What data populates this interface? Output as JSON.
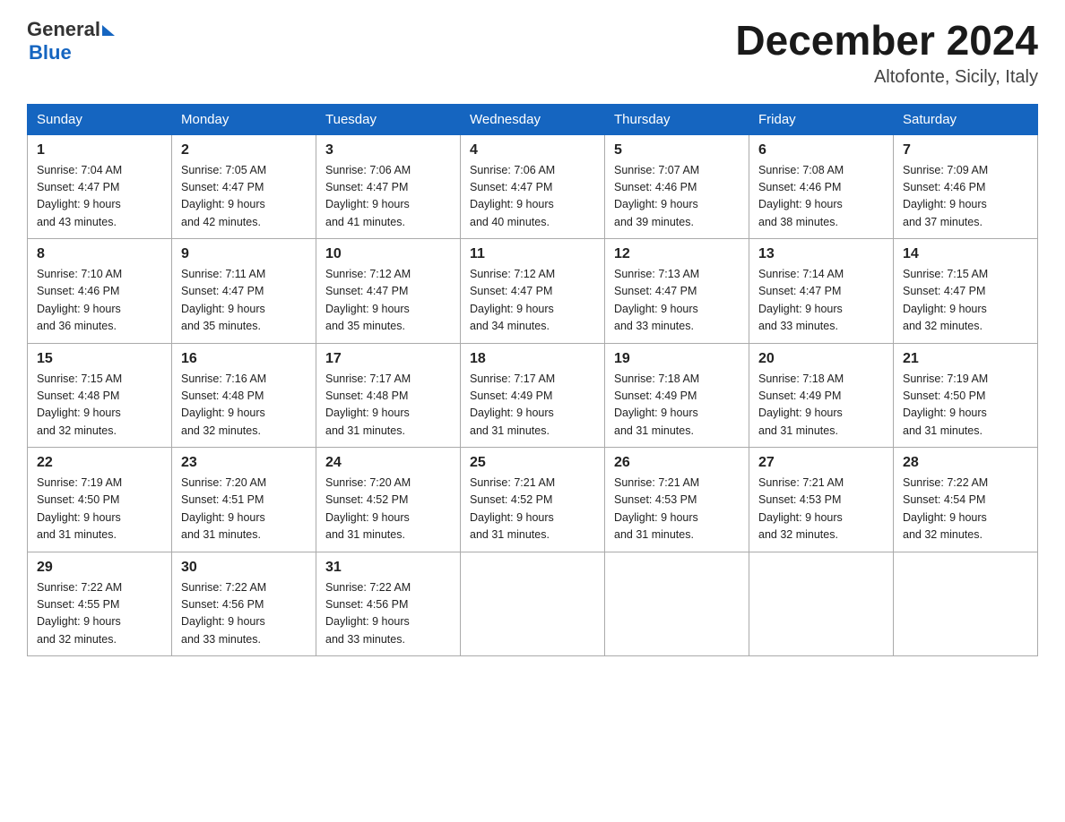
{
  "header": {
    "logo_general": "General",
    "logo_blue": "Blue",
    "month_title": "December 2024",
    "location": "Altofonte, Sicily, Italy"
  },
  "weekdays": [
    "Sunday",
    "Monday",
    "Tuesday",
    "Wednesday",
    "Thursday",
    "Friday",
    "Saturday"
  ],
  "weeks": [
    [
      {
        "day": "1",
        "sunrise": "7:04 AM",
        "sunset": "4:47 PM",
        "daylight": "9 hours and 43 minutes."
      },
      {
        "day": "2",
        "sunrise": "7:05 AM",
        "sunset": "4:47 PM",
        "daylight": "9 hours and 42 minutes."
      },
      {
        "day": "3",
        "sunrise": "7:06 AM",
        "sunset": "4:47 PM",
        "daylight": "9 hours and 41 minutes."
      },
      {
        "day": "4",
        "sunrise": "7:06 AM",
        "sunset": "4:47 PM",
        "daylight": "9 hours and 40 minutes."
      },
      {
        "day": "5",
        "sunrise": "7:07 AM",
        "sunset": "4:46 PM",
        "daylight": "9 hours and 39 minutes."
      },
      {
        "day": "6",
        "sunrise": "7:08 AM",
        "sunset": "4:46 PM",
        "daylight": "9 hours and 38 minutes."
      },
      {
        "day": "7",
        "sunrise": "7:09 AM",
        "sunset": "4:46 PM",
        "daylight": "9 hours and 37 minutes."
      }
    ],
    [
      {
        "day": "8",
        "sunrise": "7:10 AM",
        "sunset": "4:46 PM",
        "daylight": "9 hours and 36 minutes."
      },
      {
        "day": "9",
        "sunrise": "7:11 AM",
        "sunset": "4:47 PM",
        "daylight": "9 hours and 35 minutes."
      },
      {
        "day": "10",
        "sunrise": "7:12 AM",
        "sunset": "4:47 PM",
        "daylight": "9 hours and 35 minutes."
      },
      {
        "day": "11",
        "sunrise": "7:12 AM",
        "sunset": "4:47 PM",
        "daylight": "9 hours and 34 minutes."
      },
      {
        "day": "12",
        "sunrise": "7:13 AM",
        "sunset": "4:47 PM",
        "daylight": "9 hours and 33 minutes."
      },
      {
        "day": "13",
        "sunrise": "7:14 AM",
        "sunset": "4:47 PM",
        "daylight": "9 hours and 33 minutes."
      },
      {
        "day": "14",
        "sunrise": "7:15 AM",
        "sunset": "4:47 PM",
        "daylight": "9 hours and 32 minutes."
      }
    ],
    [
      {
        "day": "15",
        "sunrise": "7:15 AM",
        "sunset": "4:48 PM",
        "daylight": "9 hours and 32 minutes."
      },
      {
        "day": "16",
        "sunrise": "7:16 AM",
        "sunset": "4:48 PM",
        "daylight": "9 hours and 32 minutes."
      },
      {
        "day": "17",
        "sunrise": "7:17 AM",
        "sunset": "4:48 PM",
        "daylight": "9 hours and 31 minutes."
      },
      {
        "day": "18",
        "sunrise": "7:17 AM",
        "sunset": "4:49 PM",
        "daylight": "9 hours and 31 minutes."
      },
      {
        "day": "19",
        "sunrise": "7:18 AM",
        "sunset": "4:49 PM",
        "daylight": "9 hours and 31 minutes."
      },
      {
        "day": "20",
        "sunrise": "7:18 AM",
        "sunset": "4:49 PM",
        "daylight": "9 hours and 31 minutes."
      },
      {
        "day": "21",
        "sunrise": "7:19 AM",
        "sunset": "4:50 PM",
        "daylight": "9 hours and 31 minutes."
      }
    ],
    [
      {
        "day": "22",
        "sunrise": "7:19 AM",
        "sunset": "4:50 PM",
        "daylight": "9 hours and 31 minutes."
      },
      {
        "day": "23",
        "sunrise": "7:20 AM",
        "sunset": "4:51 PM",
        "daylight": "9 hours and 31 minutes."
      },
      {
        "day": "24",
        "sunrise": "7:20 AM",
        "sunset": "4:52 PM",
        "daylight": "9 hours and 31 minutes."
      },
      {
        "day": "25",
        "sunrise": "7:21 AM",
        "sunset": "4:52 PM",
        "daylight": "9 hours and 31 minutes."
      },
      {
        "day": "26",
        "sunrise": "7:21 AM",
        "sunset": "4:53 PM",
        "daylight": "9 hours and 31 minutes."
      },
      {
        "day": "27",
        "sunrise": "7:21 AM",
        "sunset": "4:53 PM",
        "daylight": "9 hours and 32 minutes."
      },
      {
        "day": "28",
        "sunrise": "7:22 AM",
        "sunset": "4:54 PM",
        "daylight": "9 hours and 32 minutes."
      }
    ],
    [
      {
        "day": "29",
        "sunrise": "7:22 AM",
        "sunset": "4:55 PM",
        "daylight": "9 hours and 32 minutes."
      },
      {
        "day": "30",
        "sunrise": "7:22 AM",
        "sunset": "4:56 PM",
        "daylight": "9 hours and 33 minutes."
      },
      {
        "day": "31",
        "sunrise": "7:22 AM",
        "sunset": "4:56 PM",
        "daylight": "9 hours and 33 minutes."
      },
      null,
      null,
      null,
      null
    ]
  ],
  "labels": {
    "sunrise_prefix": "Sunrise: ",
    "sunset_prefix": "Sunset: ",
    "daylight_prefix": "Daylight: 9 hours"
  }
}
